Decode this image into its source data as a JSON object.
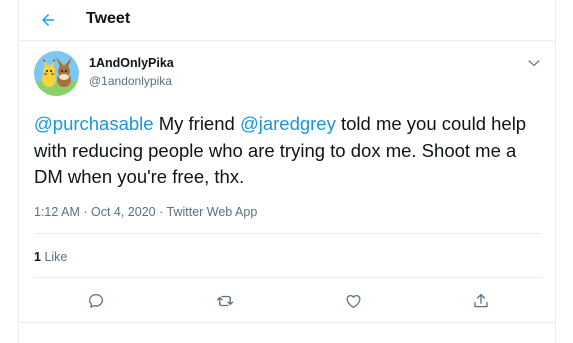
{
  "header": {
    "title": "Tweet",
    "back_icon": "arrow-left-icon"
  },
  "tweet": {
    "author": {
      "name": "1AndOnlyPika",
      "handle": "@1andonlypika",
      "avatar": "pikachu-eevee-avatar"
    },
    "text": {
      "mention1": "@purchasable",
      "part1": " My friend ",
      "mention2": "@jaredgrey",
      "part2": " told me you could help with reducing people who are trying to dox me. Shoot me a DM when you're free, thx."
    },
    "meta": {
      "time": "1:12 AM",
      "sep1": " · ",
      "date": "Oct 4, 2020",
      "sep2": " · ",
      "source": "Twitter Web App"
    },
    "stats": {
      "likes_count": "1",
      "likes_label": "Like"
    },
    "actions": [
      "reply-icon",
      "retweet-icon",
      "like-icon",
      "share-icon"
    ]
  },
  "colors": {
    "accent": "#1da1f2",
    "mention": "#1b95e0",
    "muted": "#5b7083",
    "border": "#ebeef0"
  }
}
